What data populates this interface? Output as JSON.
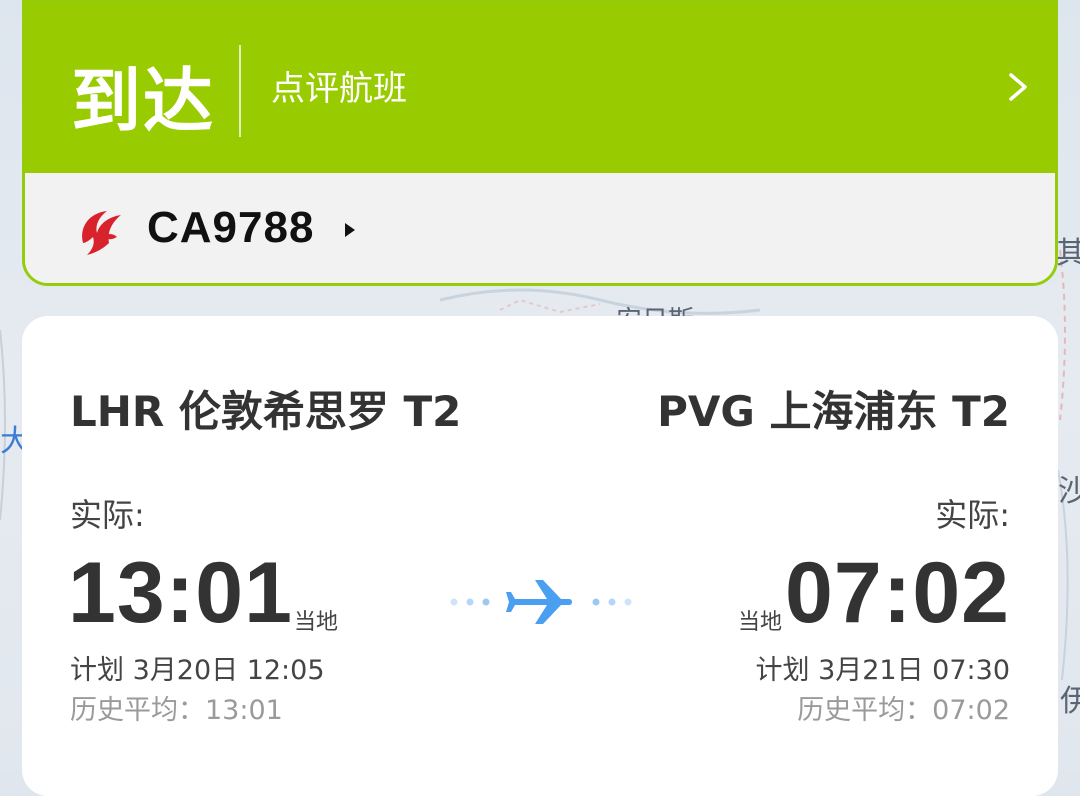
{
  "colors": {
    "status_green": "#98cc00",
    "plane_blue": "#4a9ff0",
    "airline_red": "#d9232c"
  },
  "map": {
    "labels": [
      "其",
      "安日斯",
      "大",
      "沙",
      "伊"
    ]
  },
  "status": {
    "title": "到达",
    "review_label": "点评航班",
    "chevron_icon": "chevron-right-icon"
  },
  "flight": {
    "airline_icon": "air-china-logo-icon",
    "number": "CA9788"
  },
  "departure": {
    "airport": "LHR 伦敦希思罗 T2",
    "actual_label": "实际:",
    "time": "13:01",
    "local_label": "当地",
    "scheduled": "计划 3月20日 12:05",
    "historical": "历史平均：13:01"
  },
  "arrival": {
    "airport": "PVG 上海浦东 T2",
    "actual_label": "实际:",
    "time": "07:02",
    "local_label": "当地",
    "scheduled": "计划 3月21日 07:30",
    "historical": "历史平均：07:02"
  },
  "route_icon": "airplane-icon"
}
